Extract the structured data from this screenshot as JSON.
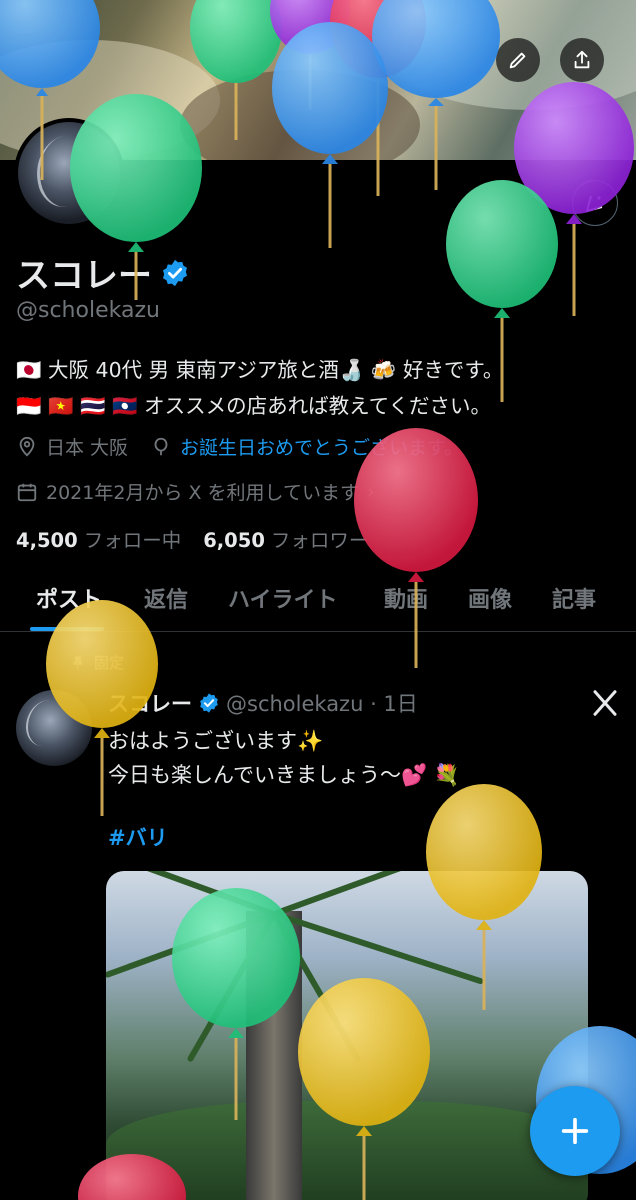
{
  "profile": {
    "name": "スコレー",
    "handle": "@scholekazu",
    "bio_line1": "🇯🇵 大阪 40代 男 東南アジア旅と酒🍶 🍻 好きです。",
    "bio_line2": "🇮🇩 🇻🇳 🇹🇭 🇱🇦 オススメの店あれば教えてください。",
    "location": "日本 大阪",
    "birthday": "お誕生日おめでとうございます。",
    "joined": "2021年2月から X を利用しています",
    "following_count": "4,500",
    "following_label": "フォロー中",
    "followers_count": "6,050",
    "followers_label": "フォロワー"
  },
  "tabs": [
    "ポスト",
    "返信",
    "ハイライト",
    "動画",
    "画像",
    "記事"
  ],
  "post": {
    "pinned_label": "固定",
    "name": "スコレー",
    "handle_time": "@scholekazu · 1日",
    "line1": "おはようございます✨",
    "line2": "今日も楽しんでいきましょう〜💕 💐",
    "hashtag": "#バリ"
  },
  "colors": {
    "accent": "#1d9bf0",
    "muted": "#71767b",
    "balloon_green": "#2fd48a",
    "balloon_blue": "#3a9ff2",
    "balloon_purple": "#a43bf0",
    "balloon_red": "#e8294f",
    "balloon_yellow": "#f3c51b"
  },
  "icons": {
    "back": "arrow-left-icon",
    "search": "search-icon",
    "edit": "pencil-icon",
    "share": "share-icon",
    "birthday_hat": "party-icon",
    "location": "pin-icon",
    "birthday": "balloon-icon",
    "calendar": "calendar-icon",
    "verified": "verified-badge-icon",
    "pin": "pin-post-icon",
    "grok": "grok-icon",
    "compose": "plus-icon"
  }
}
